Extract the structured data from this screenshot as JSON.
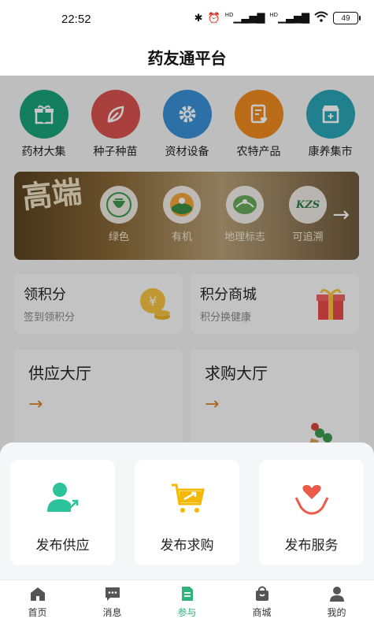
{
  "status_bar": {
    "time": "22:52",
    "battery": "49",
    "signal_1": "HD",
    "signal_2": "HD"
  },
  "header": {
    "title": "药友通平台"
  },
  "categories": [
    {
      "label": "药材大集",
      "icon": "gift-box-icon",
      "color": "#1aa37a"
    },
    {
      "label": "种子种苗",
      "icon": "leaf-icon",
      "color": "#d9534f"
    },
    {
      "label": "资材设备",
      "icon": "gear-icon",
      "color": "#3a8fd6"
    },
    {
      "label": "农特产品",
      "icon": "document-heart-icon",
      "color": "#ee8a1e"
    },
    {
      "label": "康养集市",
      "icon": "storefront-icon",
      "color": "#2aa5b5"
    }
  ],
  "banner": {
    "calligraphy": "高端",
    "badges": [
      {
        "label": "绿色",
        "icon": "green-food-logo-icon"
      },
      {
        "label": "有机",
        "icon": "organic-logo-icon"
      },
      {
        "label": "地理标志",
        "icon": "geo-indication-logo-icon"
      },
      {
        "label": "可追溯",
        "icon_text": "KZS"
      }
    ]
  },
  "points": [
    {
      "title": "领积分",
      "subtitle": "签到领积分",
      "icon": "coin-bag-icon"
    },
    {
      "title": "积分商城",
      "subtitle": "积分换健康",
      "icon": "gift-icon"
    }
  ],
  "halls": [
    {
      "title": "供应大厅",
      "icon": "lingzhi-mushroom-icon"
    },
    {
      "title": "求购大厅",
      "icon": "ginseng-root-icon"
    }
  ],
  "publish_actions": [
    {
      "label": "发布供应",
      "icon": "person-upload-icon",
      "color": "#2cc39a"
    },
    {
      "label": "发布求购",
      "icon": "shopping-cart-icon",
      "color": "#f5b800"
    },
    {
      "label": "发布服务",
      "icon": "hands-heart-icon",
      "color": "#ee5a4a"
    }
  ],
  "tabbar": {
    "active_color": "#2fb37a",
    "items": [
      {
        "label": "首页",
        "icon": "home-icon"
      },
      {
        "label": "消息",
        "icon": "message-icon"
      },
      {
        "label": "参与",
        "icon": "document-icon",
        "active": true
      },
      {
        "label": "商城",
        "icon": "shopping-bag-icon"
      },
      {
        "label": "我的",
        "icon": "person-icon"
      }
    ]
  }
}
